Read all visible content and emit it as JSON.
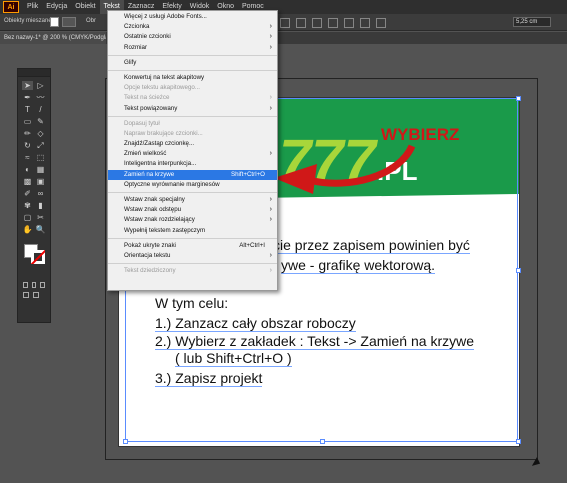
{
  "menubar": {
    "logo": "Ai",
    "items": [
      "Plik",
      "Edycja",
      "Obiekt",
      "Tekst",
      "Zaznacz",
      "Efekty",
      "Widok",
      "Okno",
      "Pomoc"
    ],
    "active_index": 3
  },
  "controlbar": {
    "label": "Obiekty mieszane",
    "dropdown_fragment": "Obr",
    "size_value": "5,25 cm"
  },
  "document_tab": "Bez nazwy-1* @ 200 % (CMYK/Podgląd)",
  "text_menu": {
    "items": [
      {
        "label": "Więcej z usługi Adobe Fonts...",
        "enabled": true,
        "submenu": false,
        "shortcut": ""
      },
      {
        "label": "Czcionka",
        "enabled": true,
        "submenu": true,
        "shortcut": ""
      },
      {
        "label": "Ostatnie czcionki",
        "enabled": true,
        "submenu": true,
        "shortcut": ""
      },
      {
        "label": "Rozmiar",
        "enabled": true,
        "submenu": true,
        "shortcut": ""
      },
      {
        "sep": true
      },
      {
        "label": "Glify",
        "enabled": true,
        "submenu": false,
        "shortcut": ""
      },
      {
        "sep": true
      },
      {
        "label": "Konwertuj na tekst akapitowy",
        "enabled": true,
        "submenu": false,
        "shortcut": ""
      },
      {
        "label": "Opcje tekstu akapitowego...",
        "enabled": false,
        "submenu": false,
        "shortcut": ""
      },
      {
        "label": "Tekst na ścieżce",
        "enabled": false,
        "submenu": true,
        "shortcut": ""
      },
      {
        "label": "Tekst powiązowany",
        "enabled": true,
        "submenu": true,
        "shortcut": ""
      },
      {
        "sep": true
      },
      {
        "label": "Dopasuj tytuł",
        "enabled": false,
        "submenu": false,
        "shortcut": ""
      },
      {
        "label": "Napraw brakujące czcionki...",
        "enabled": false,
        "submenu": false,
        "shortcut": ""
      },
      {
        "label": "Znajdź/Zastąp czcionkę...",
        "enabled": true,
        "submenu": false,
        "shortcut": ""
      },
      {
        "label": "Zmień wielkość",
        "enabled": true,
        "submenu": true,
        "shortcut": ""
      },
      {
        "label": "Inteligentna interpunkcja...",
        "enabled": true,
        "submenu": false,
        "shortcut": ""
      },
      {
        "label": "Zamień na krzywe",
        "enabled": true,
        "submenu": false,
        "shortcut": "Shift+Ctrl+O",
        "highlighted": true
      },
      {
        "label": "Optyczne wyrównanie marginesów",
        "enabled": true,
        "submenu": false,
        "shortcut": ""
      },
      {
        "sep": true
      },
      {
        "label": "Wstaw znak specjalny",
        "enabled": true,
        "submenu": true,
        "shortcut": ""
      },
      {
        "label": "Wstaw znak odstępu",
        "enabled": true,
        "submenu": true,
        "shortcut": ""
      },
      {
        "label": "Wstaw znak rozdzielający",
        "enabled": true,
        "submenu": true,
        "shortcut": ""
      },
      {
        "label": "Wypełnij tekstem zastępczym",
        "enabled": true,
        "submenu": false,
        "shortcut": ""
      },
      {
        "sep": true
      },
      {
        "label": "Pokaż ukryte znaki",
        "enabled": true,
        "submenu": false,
        "shortcut": "Alt+Ctrl+I"
      },
      {
        "label": "Orientacja tekstu",
        "enabled": true,
        "submenu": true,
        "shortcut": ""
      },
      {
        "sep": true
      },
      {
        "label": "Tekst dziedziczony",
        "enabled": false,
        "submenu": true,
        "shortcut": ""
      }
    ]
  },
  "banner": {
    "headline": "WYBIERZ",
    "digits": "777",
    "domain": ".PL",
    "colors": {
      "green": "#1a9a4a",
      "lime": "#a8d63a",
      "red": "#d01818",
      "white": "#ffffff"
    }
  },
  "artboard_text": {
    "line1": "cie przez zapisem powinien być",
    "line2": "ywe - grafikę wektorową.",
    "heading": "W tym celu:",
    "steps": [
      "1.) Zanzacz cały obszar roboczy",
      "2.) Wybierz z zakładek : Tekst -> Zamień na krzywe",
      "( lub Shift+Ctrl+O )",
      "3.) Zapisz projekt"
    ]
  },
  "tools": [
    "selection-tool",
    "direct-selection-tool",
    "pen-tool",
    "curvature-tool",
    "type-tool",
    "line-tool",
    "rectangle-tool",
    "paintbrush-tool",
    "pencil-tool",
    "eraser-tool",
    "rotate-tool",
    "scale-tool",
    "width-tool",
    "free-transform-tool",
    "shape-builder-tool",
    "perspective-tool",
    "mesh-tool",
    "gradient-tool",
    "eyedropper-tool",
    "blend-tool",
    "symbol-sprayer-tool",
    "column-graph-tool",
    "artboard-tool",
    "slice-tool",
    "hand-tool",
    "zoom-tool"
  ],
  "tool_glyphs": [
    "➤",
    "▷",
    "✒",
    "〰",
    "T",
    "/",
    "▭",
    "✎",
    "✏",
    "◇",
    "↻",
    "⤢",
    "≈",
    "⬚",
    "◐",
    "▦",
    "▩",
    "▣",
    "✐",
    "∞",
    "✾",
    "▮",
    "▢",
    "✂",
    "✋",
    "🔍"
  ],
  "accent_color": "#2b78e4"
}
